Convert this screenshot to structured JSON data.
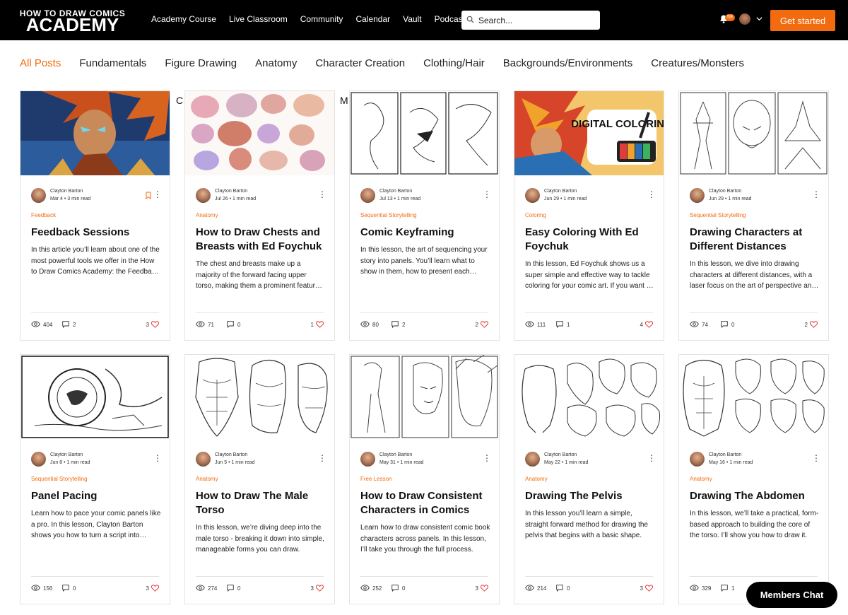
{
  "brand": {
    "logo_top": "HOW TO DRAW COMICS",
    "logo_main": "ACADEMY"
  },
  "nav": [
    "Academy Course",
    "Live Classroom",
    "Community",
    "Calendar",
    "Vault",
    "Podcast"
  ],
  "search": {
    "placeholder": "Search..."
  },
  "notifications": {
    "count": "59"
  },
  "cta_label": "Get started",
  "categories": [
    {
      "label": "All Posts",
      "active": true
    },
    {
      "label": "Fundamentals"
    },
    {
      "label": "Figure Drawing"
    },
    {
      "label": "Anatomy"
    },
    {
      "label": "Character Creation"
    },
    {
      "label": "Clothing/Hair"
    },
    {
      "label": "Backgrounds/Environments"
    },
    {
      "label": "Creatures/Monsters"
    }
  ],
  "stray_letters": [
    "C",
    "M"
  ],
  "accent_color": "#f36b0f",
  "posts": [
    {
      "author": "Clayton Barton",
      "date": "Mar 4",
      "read": "3 min read",
      "category": "Feedback",
      "title": "Feedback Sessions",
      "excerpt": "In this article you’ll learn about one of the most powerful tools we offer in the How to Draw Comics Academy: the Feedback Sessions.",
      "views": "404",
      "comments": "2",
      "likes": "3",
      "image": "color-warrior-illustration"
    },
    {
      "author": "Clayton Barton",
      "date": "Jul 26",
      "read": "1 min read",
      "category": "Anatomy",
      "title": "How to Draw Chests and Breasts with Ed Foychuk",
      "excerpt": "The chest and breasts make up a majority of the forward facing upper torso, making them a prominent feature to draw.",
      "views": "71",
      "comments": "0",
      "likes": "1",
      "image": "chest-anatomy-studies"
    },
    {
      "author": "Clayton Barton",
      "date": "Jul 13",
      "read": "1 min read",
      "category": "Sequential Storytelling",
      "title": "Comic Keyframing",
      "excerpt": "In this lesson, the art of sequencing your story into panels. You’ll learn what to show in them, how to present each moment.",
      "views": "80",
      "comments": "2",
      "likes": "2",
      "image": "keyframe-panels"
    },
    {
      "author": "Clayton Barton",
      "date": "Jun 29",
      "read": "1 min read",
      "category": "Coloring",
      "title": "Easy Coloring With Ed Foychuk",
      "excerpt": "In this lesson, Ed Foychuk shows us a super simple and effective way to tackle coloring for your comic art. If you want to learn.",
      "views": "111",
      "comments": "1",
      "likes": "4",
      "image": "digital-coloring",
      "image_text": "DIGITAL COLORING"
    },
    {
      "author": "Clayton Barton",
      "date": "Jun 29",
      "read": "1 min read",
      "category": "Sequential Storytelling",
      "title": "Drawing Characters at Different Distances",
      "excerpt": "In this lesson, we dive into drawing characters at different distances, with a laser focus on the art of perspective and scale.",
      "views": "74",
      "comments": "0",
      "likes": "2",
      "image": "distance-panels"
    },
    {
      "author": "Clayton Barton",
      "date": "Jun 8",
      "read": "1 min read",
      "category": "Sequential Storytelling",
      "title": "Panel Pacing",
      "excerpt": "Learn how to pace your comic panels like a pro. In this lesson, Clayton Barton shows you how to turn a script into panels.",
      "views": "156",
      "comments": "0",
      "likes": "3",
      "image": "astronaut-sketch"
    },
    {
      "author": "Clayton Barton",
      "date": "Jun 5",
      "read": "1 min read",
      "category": "Anatomy",
      "title": "How to Draw The Male Torso",
      "excerpt": "In this lesson, we’re diving deep into the male torso - breaking it down into simple, manageable forms you can draw.",
      "views": "274",
      "comments": "0",
      "likes": "3",
      "image": "male-torso-sketches"
    },
    {
      "author": "Clayton Barton",
      "date": "May 31",
      "read": "1 min read",
      "category": "Free Lesson",
      "title": "How to Draw Consistent Characters in Comics",
      "excerpt": "Learn how to draw consistent comic book characters across panels. In this lesson, I’ll take you through the full process.",
      "views": "252",
      "comments": "0",
      "likes": "3",
      "image": "consistent-character-panels"
    },
    {
      "author": "Clayton Barton",
      "date": "May 22",
      "read": "1 min read",
      "category": "Anatomy",
      "title": "Drawing The Pelvis",
      "excerpt": "In this lesson you’ll learn a simple, straight forward method for drawing the pelvis that begins with a basic shape.",
      "views": "214",
      "comments": "0",
      "likes": "3",
      "image": "pelvis-sketches"
    },
    {
      "author": "Clayton Barton",
      "date": "May 16",
      "read": "1 min read",
      "category": "Anatomy",
      "title": "Drawing The Abdomen",
      "excerpt": "In this lesson, we’ll take a practical, form-based approach to building the core of the torso. I’ll show you how to draw it.",
      "views": "329",
      "comments": "1",
      "likes": "",
      "image": "abdomen-sketches"
    }
  ],
  "chat_button": "Members Chat"
}
